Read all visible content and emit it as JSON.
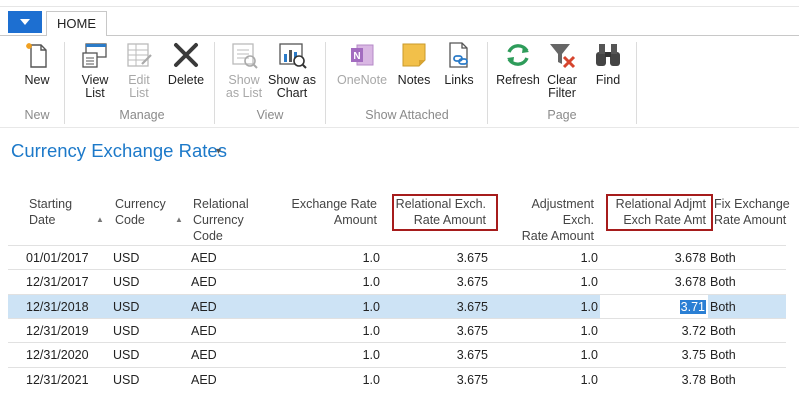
{
  "ribbon": {
    "tab": "HOME",
    "groups": {
      "new": "New",
      "manage": "Manage",
      "view": "View",
      "show_attached": "Show Attached",
      "page": "Page"
    },
    "buttons": {
      "new": "New",
      "view_list": [
        "View",
        "List"
      ],
      "edit_list": [
        "Edit",
        "List"
      ],
      "delete": "Delete",
      "show_as_list": [
        "Show",
        "as List"
      ],
      "show_as_chart": [
        "Show as",
        "Chart"
      ],
      "onenote": "OneNote",
      "notes": "Notes",
      "links": "Links",
      "refresh": "Refresh",
      "clear_filter": [
        "Clear",
        "Filter"
      ],
      "find": "Find"
    }
  },
  "page": {
    "title": "Currency Exchange Rates",
    "chevron": "▾"
  },
  "table": {
    "headers": {
      "starting_date": [
        "Starting",
        "Date"
      ],
      "currency_code": [
        "Currency",
        "Code"
      ],
      "relational_currency_code": [
        "Relational",
        "Currency",
        "Code"
      ],
      "exchange_rate_amount": [
        "Exchange Rate",
        "Amount"
      ],
      "relational_exch_rate_amount": [
        "Relational Exch.",
        "Rate Amount"
      ],
      "adjustment_exch_rate_amount": [
        "Adjustment Exch.",
        "Rate Amount"
      ],
      "relational_adjmt_exch_rate_amt": [
        "Relational Adjmt",
        "Exch Rate Amt"
      ],
      "fix_exchange_rate_amount": [
        "Fix Exchange",
        "Rate Amount"
      ]
    },
    "rows": [
      {
        "date": "01/01/2017",
        "currency": "USD",
        "rel_currency": "AED",
        "exch": "1.0",
        "rel_exch": "3.675",
        "adj": "1.0",
        "rel_adj": "3.678",
        "fix": "Both"
      },
      {
        "date": "12/31/2017",
        "currency": "USD",
        "rel_currency": "AED",
        "exch": "1.0",
        "rel_exch": "3.675",
        "adj": "1.0",
        "rel_adj": "3.678",
        "fix": "Both"
      },
      {
        "date": "12/31/2018",
        "currency": "USD",
        "rel_currency": "AED",
        "exch": "1.0",
        "rel_exch": "3.675",
        "adj": "1.0",
        "rel_adj": "3.71",
        "fix": "Both"
      },
      {
        "date": "12/31/2019",
        "currency": "USD",
        "rel_currency": "AED",
        "exch": "1.0",
        "rel_exch": "3.675",
        "adj": "1.0",
        "rel_adj": "3.72",
        "fix": "Both"
      },
      {
        "date": "12/31/2020",
        "currency": "USD",
        "rel_currency": "AED",
        "exch": "1.0",
        "rel_exch": "3.675",
        "adj": "1.0",
        "rel_adj": "3.75",
        "fix": "Both"
      },
      {
        "date": "12/31/2021",
        "currency": "USD",
        "rel_currency": "AED",
        "exch": "1.0",
        "rel_exch": "3.675",
        "adj": "1.0",
        "rel_adj": "3.78",
        "fix": "Both"
      }
    ],
    "selected_row": 2
  },
  "colors": {
    "accent": "#1c79c9",
    "highlight_box": "#a61c1c",
    "selected_row": "#cde3f5"
  }
}
